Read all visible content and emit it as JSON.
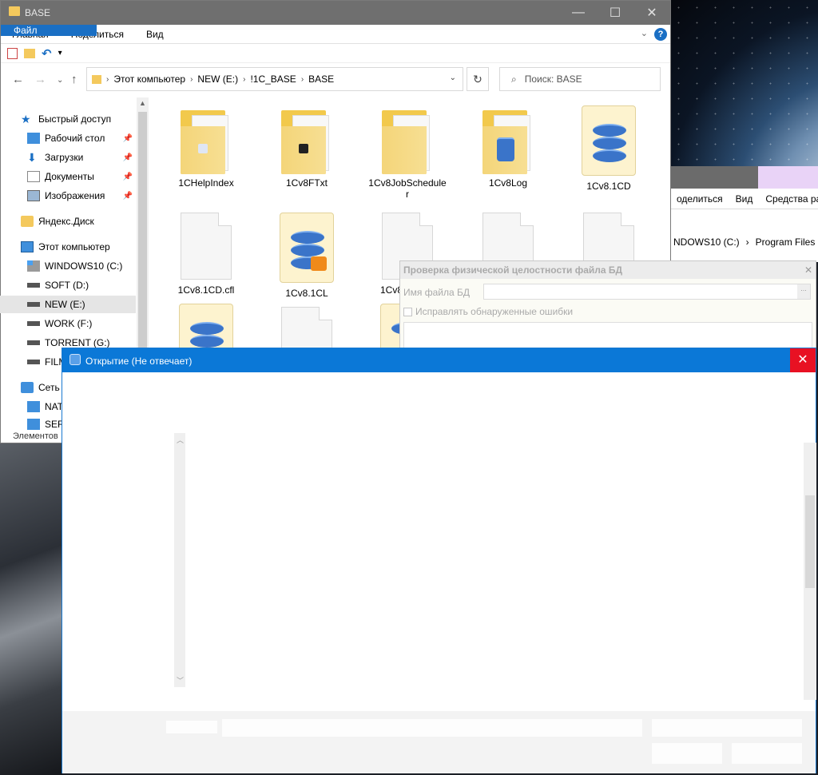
{
  "explorer": {
    "title": "BASE",
    "controls": {
      "minimize": "—",
      "maximize": "☐",
      "close": "✕"
    },
    "tabs": [
      "Файл",
      "Главная",
      "Поделиться",
      "Вид"
    ],
    "help": "?",
    "breadcrumb": [
      "Этот компьютер",
      "NEW (E:)",
      "!1C_BASE",
      "BASE"
    ],
    "search_placeholder": "Поиск: BASE",
    "sidebar": [
      {
        "label": "Быстрый доступ",
        "icon": "star-icon",
        "pinned": false
      },
      {
        "label": "Рабочий стол",
        "icon": "desktop-icon",
        "pinned": true
      },
      {
        "label": "Загрузки",
        "icon": "download-icon",
        "pinned": true
      },
      {
        "label": "Документы",
        "icon": "document-icon",
        "pinned": true
      },
      {
        "label": "Изображения",
        "icon": "pictures-icon",
        "pinned": true
      },
      {
        "label": "Яндекс.Диск",
        "icon": "cloud-icon",
        "pinned": false
      },
      {
        "label": "Этот компьютер",
        "icon": "computer-icon",
        "pinned": false
      },
      {
        "label": "WINDOWS10 (C:)",
        "icon": "windows-drive-icon",
        "pinned": false
      },
      {
        "label": "SOFT (D:)",
        "icon": "drive-icon",
        "pinned": false
      },
      {
        "label": "NEW (E:)",
        "icon": "drive-icon",
        "pinned": false
      },
      {
        "label": "WORK (F:)",
        "icon": "drive-icon",
        "pinned": false
      },
      {
        "label": "TORRENT (G:)",
        "icon": "drive-icon",
        "pinned": false
      },
      {
        "label": "FILM",
        "icon": "drive-icon",
        "pinned": false
      },
      {
        "label": "Сеть",
        "icon": "network-icon",
        "pinned": false
      },
      {
        "label": "NAT",
        "icon": "network-computer-icon",
        "pinned": false
      },
      {
        "label": "SERG",
        "icon": "network-computer-icon",
        "pinned": false
      }
    ],
    "files": [
      {
        "label": "1CHelpIndex",
        "kind": "folder"
      },
      {
        "label": "1Cv8FTxt",
        "kind": "folder"
      },
      {
        "label": "1Cv8JobScheduler",
        "kind": "folder"
      },
      {
        "label": "1Cv8Log",
        "kind": "folder-db"
      },
      {
        "label": "1Cv8.1CD",
        "kind": "database"
      },
      {
        "label": "1Cv8.1CD.cfl",
        "kind": "file"
      },
      {
        "label": "1Cv8.1CL",
        "kind": "database-locked"
      },
      {
        "label": "1Cv8",
        "kind": "file"
      }
    ],
    "status": "Элементов"
  },
  "explorer2": {
    "ribbon": [
      "оделиться",
      "Вид",
      "Средства ра"
    ],
    "breadcrumb": [
      "NDOWS10 (C:)",
      "Program Files"
    ]
  },
  "check_dialog": {
    "title": "Проверка физической целостности файла БД",
    "file_label": "Имя файла БД",
    "fix_label": "Исправлять обнаруженные ошибки"
  },
  "open_dialog": {
    "title": "Открытие (Не отвечает)"
  }
}
